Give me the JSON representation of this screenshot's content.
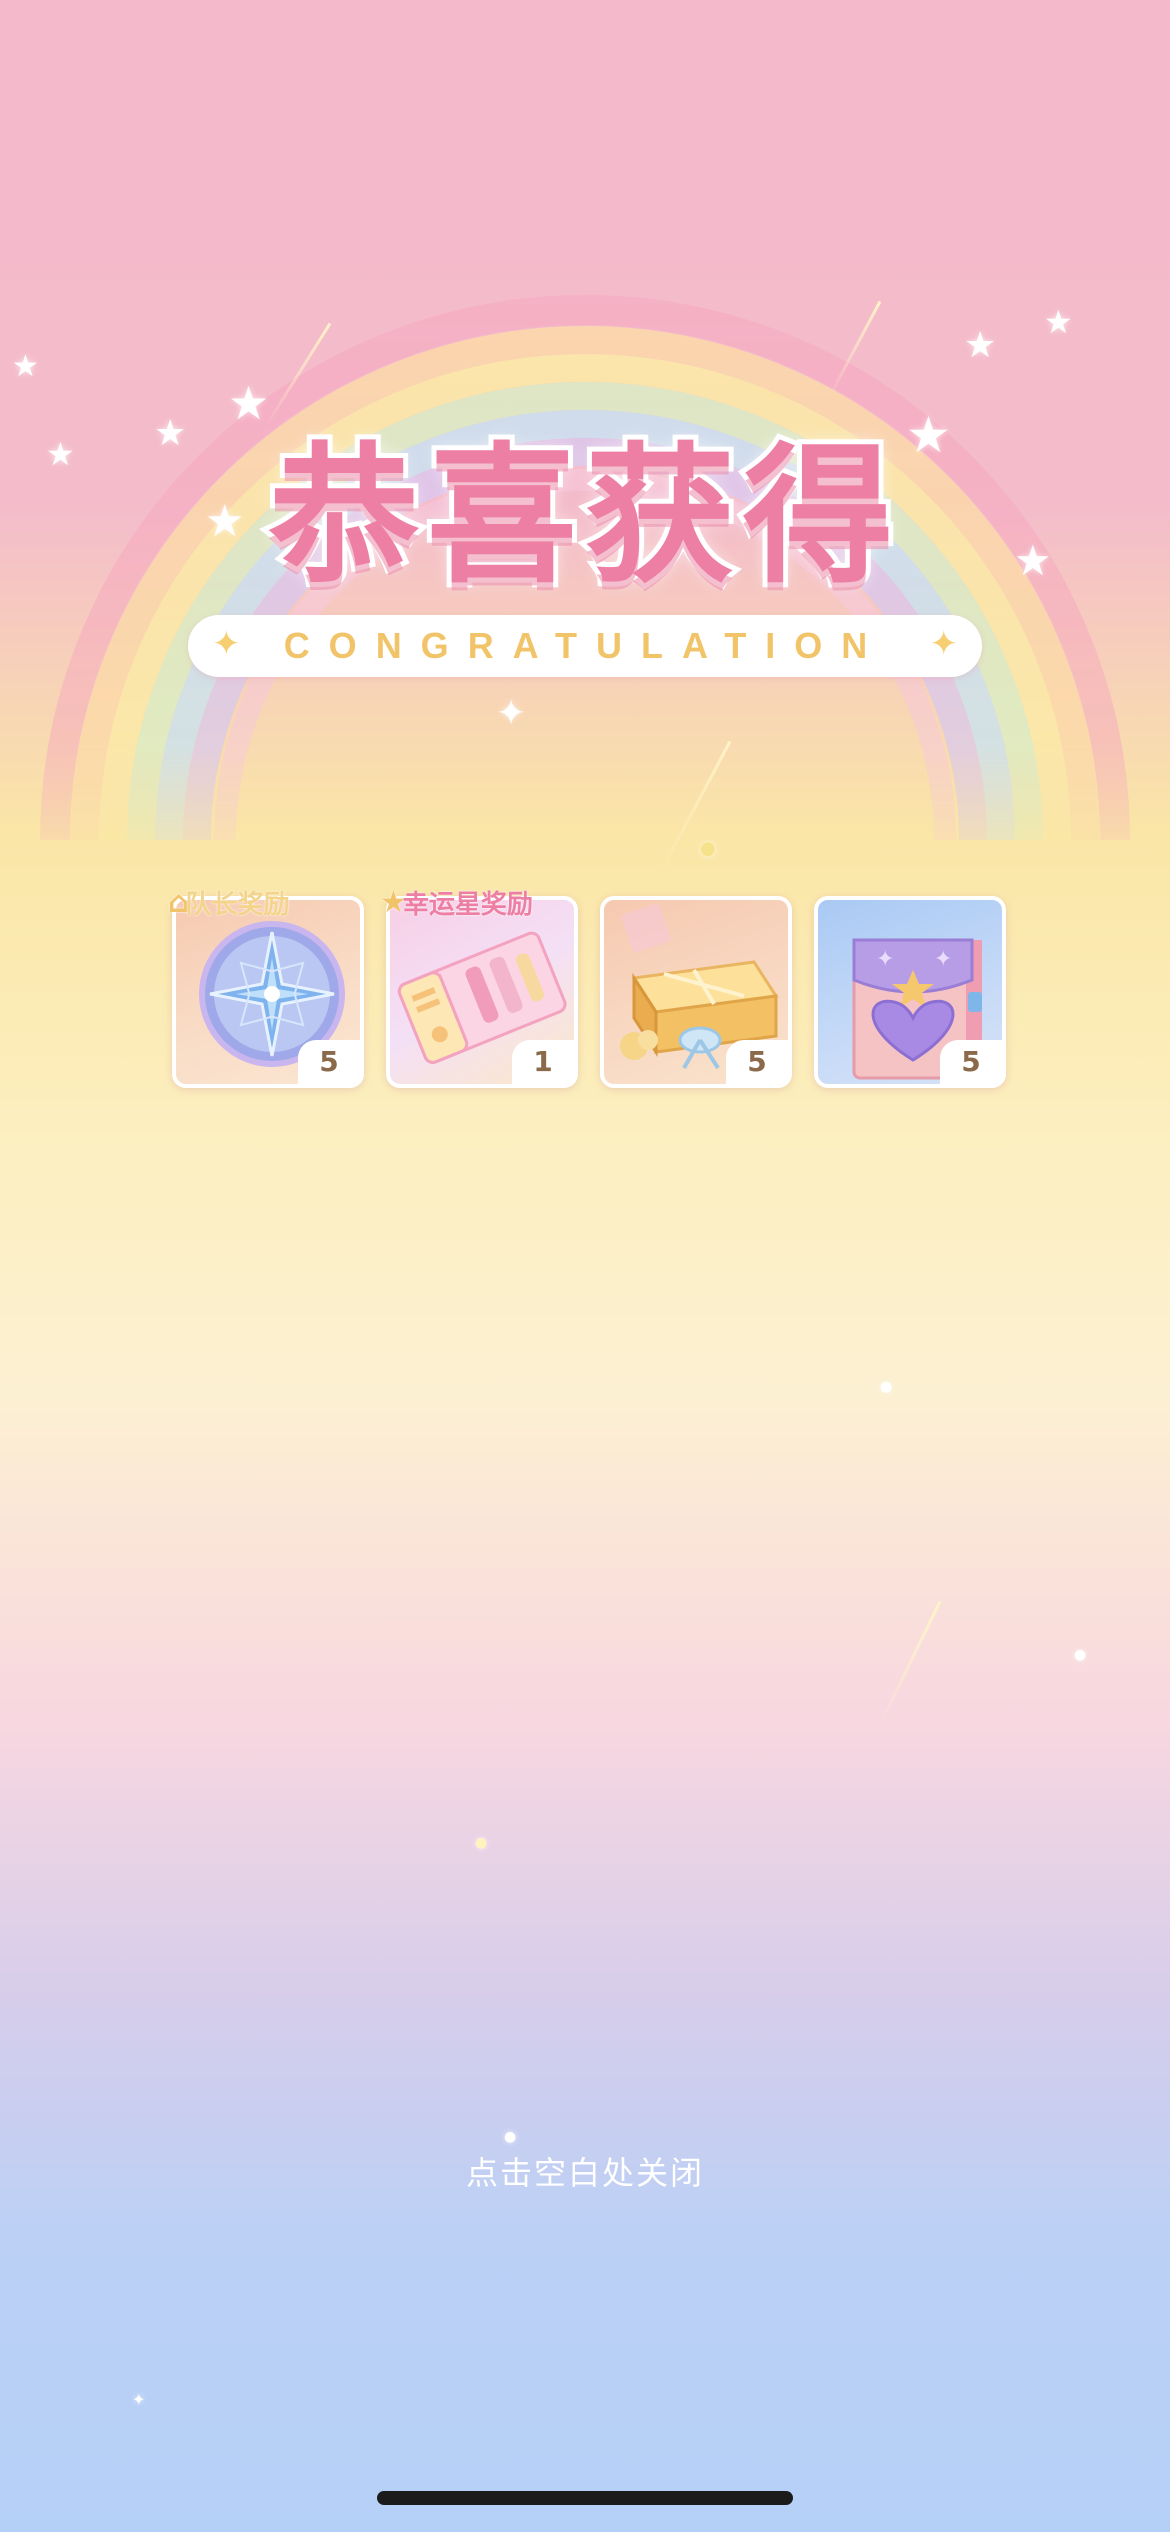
{
  "popup": {
    "title": "恭喜获得",
    "subtitle": "CONGRATULATION",
    "close_hint": "点击空白处关闭"
  },
  "rewards": [
    {
      "name": "compass-medal",
      "tag": "队长奖励",
      "tag_color": "#f3d48a",
      "count": "5"
    },
    {
      "name": "lucky-ticket",
      "tag": "幸运星奖励",
      "tag_color": "#ee7fa4",
      "count": "1"
    },
    {
      "name": "gift-box",
      "tag": "",
      "count": "5"
    },
    {
      "name": "heart-pouch",
      "tag": "",
      "count": "5"
    }
  ],
  "colors": {
    "title_pink": "#ee7fa4",
    "gold": "#f2c46a",
    "count_text": "#8a6a4a"
  }
}
